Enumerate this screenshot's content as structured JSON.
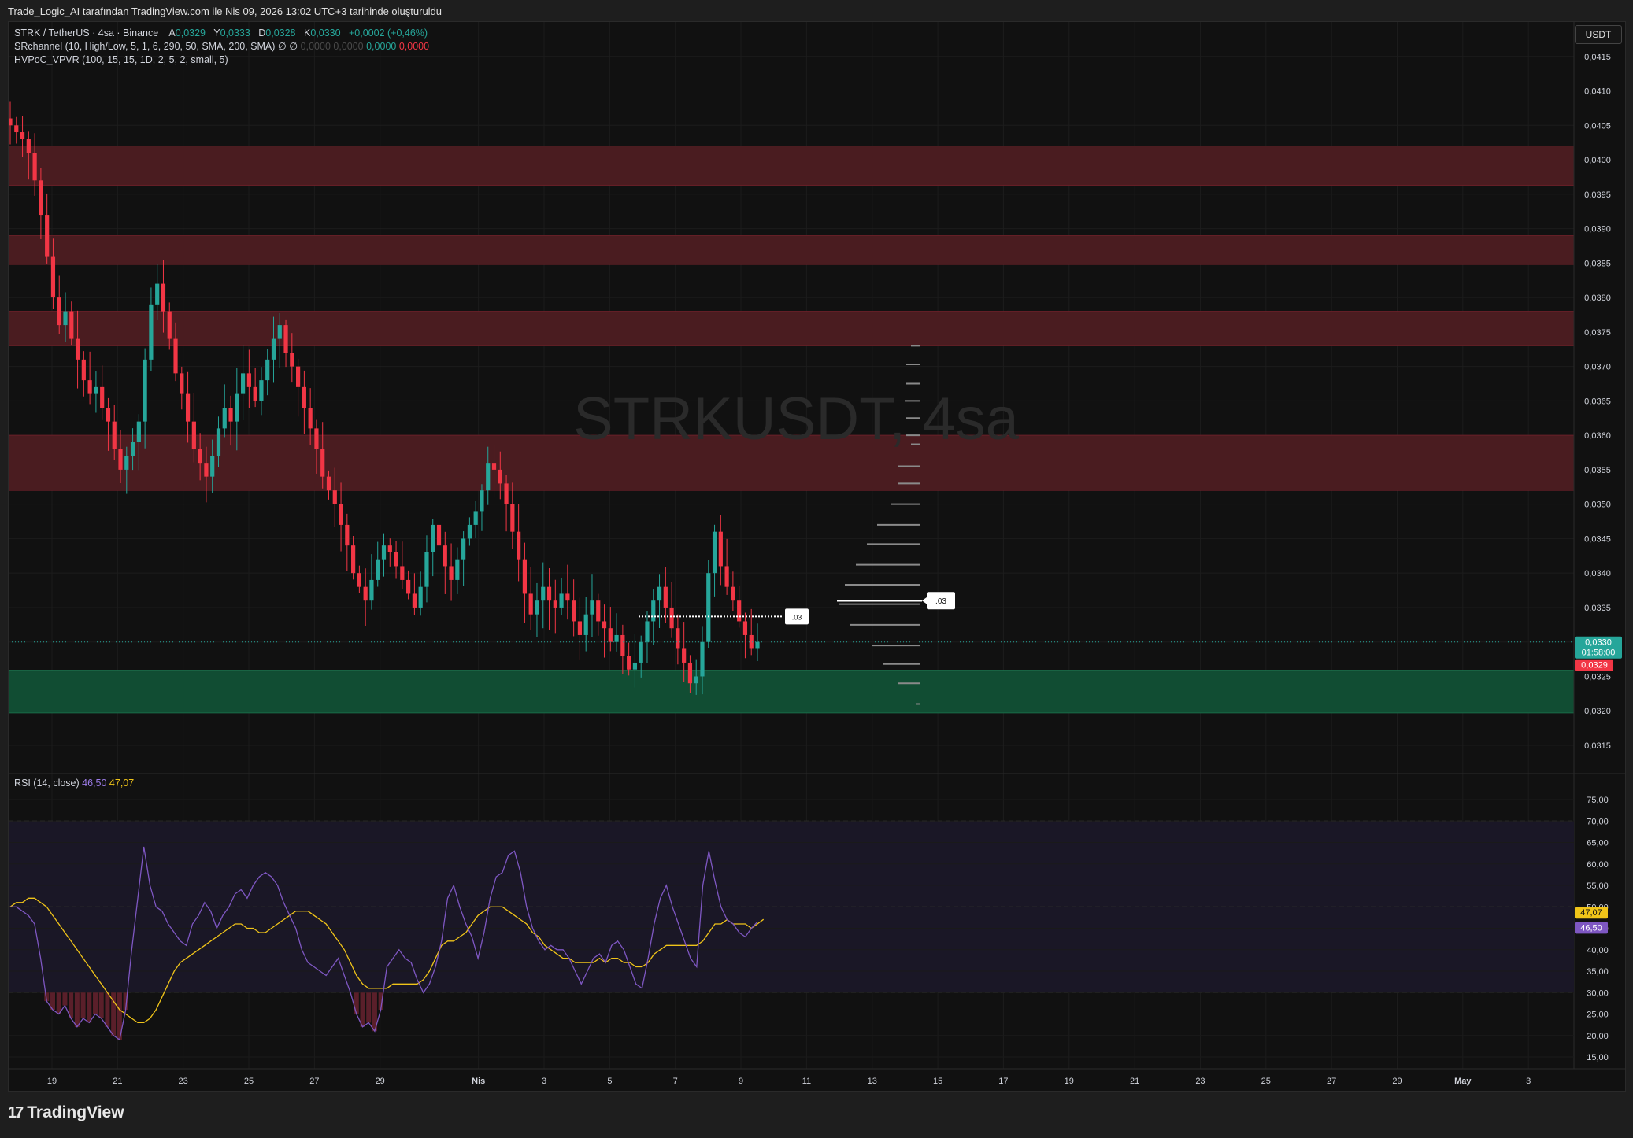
{
  "caption": "Trade_Logic_AI tarafından TradingView.com ile Nis 09, 2026 13:02 UTC+3 tarihinde oluşturuldu",
  "currency_button": "USDT",
  "watermark": "STRKUSDT, 4sa",
  "footer_logo": "TradingView",
  "legend": {
    "symbol": "STRK / TetherUS · 4sa · Binance",
    "ohlc": [
      {
        "k": "A",
        "v": "0,0329"
      },
      {
        "k": "Y",
        "v": "0,0333"
      },
      {
        "k": "D",
        "v": "0,0328"
      },
      {
        "k": "K",
        "v": "0,0330"
      }
    ],
    "change": "+0,0002 (+0,46%)",
    "srchannel": "SRchannel (10, High/Low, 5, 1, 6, 290, 50, SMA, 200, SMA)",
    "sr_icons": "∅  ∅",
    "sr_values": {
      "v1": "0,0000",
      "v2": "0,0000",
      "v3": "0,0000",
      "v4": "0,0000"
    },
    "hvpoc": "HVPoC_VPVR (100, 15, 15, 1D, 2, 5, 2, small, 5)"
  },
  "rsi_legend": {
    "name": "RSI (14, close)",
    "rsi": "46,50",
    "ma": "47,07"
  },
  "colors": {
    "up": "#26a69a",
    "down": "#f23645",
    "resistance": "#4a1c20",
    "support": "#114d33",
    "rsi": "#7e57c2",
    "rsi_ma": "#f0c419"
  },
  "chart_data": [
    {
      "type": "candlestick",
      "title": "STRK / TetherUS · 4sa · Binance",
      "ylim": [
        0.0311,
        0.042
      ],
      "y_ticks": [
        "0,0415",
        "0,0410",
        "0,0405",
        "0,0400",
        "0,0395",
        "0,0390",
        "0,0385",
        "0,0380",
        "0,0375",
        "0,0370",
        "0,0365",
        "0,0360",
        "0,0355",
        "0,0350",
        "0,0345",
        "0,0340",
        "0,0335",
        "0,0330",
        "0,0325",
        "0,0320",
        "0,0315"
      ],
      "x_ticks": [
        {
          "day": 19,
          "label": "19"
        },
        {
          "day": 21,
          "label": "21"
        },
        {
          "day": 23,
          "label": "23"
        },
        {
          "day": 25,
          "label": "25"
        },
        {
          "day": 27,
          "label": "27"
        },
        {
          "day": 29,
          "label": "29"
        },
        {
          "day": 32,
          "label": "Nis"
        },
        {
          "day": 34,
          "label": "3"
        },
        {
          "day": 36,
          "label": "5"
        },
        {
          "day": 38,
          "label": "7"
        },
        {
          "day": 40,
          "label": "9"
        },
        {
          "day": 42,
          "label": "11"
        },
        {
          "day": 44,
          "label": "13"
        },
        {
          "day": 46,
          "label": "15"
        },
        {
          "day": 48,
          "label": "17"
        },
        {
          "day": 50,
          "label": "19"
        },
        {
          "day": 52,
          "label": "21"
        },
        {
          "day": 54,
          "label": "23"
        },
        {
          "day": 56,
          "label": "25"
        },
        {
          "day": 58,
          "label": "27"
        },
        {
          "day": 60,
          "label": "29"
        },
        {
          "day": 62,
          "label": "May"
        },
        {
          "day": 64,
          "label": "3"
        }
      ],
      "zones": [
        {
          "kind": "resistance",
          "low": 0.03963,
          "high": 0.0402
        },
        {
          "kind": "resistance",
          "low": 0.03848,
          "high": 0.0389
        },
        {
          "kind": "resistance",
          "low": 0.0373,
          "high": 0.0378
        },
        {
          "kind": "resistance",
          "low": 0.0352,
          "high": 0.036
        },
        {
          "kind": "support",
          "low": 0.03197,
          "high": 0.03259
        }
      ],
      "closes": [
        0.0405,
        0.0404,
        0.0403,
        0.0401,
        0.0397,
        0.0392,
        0.0386,
        0.038,
        0.0376,
        0.0378,
        0.0374,
        0.0371,
        0.0368,
        0.0366,
        0.0367,
        0.0364,
        0.0362,
        0.0358,
        0.0355,
        0.0357,
        0.0359,
        0.0362,
        0.0371,
        0.0379,
        0.0382,
        0.0378,
        0.0374,
        0.0369,
        0.0366,
        0.0362,
        0.0358,
        0.0356,
        0.0354,
        0.0357,
        0.0361,
        0.0364,
        0.0362,
        0.0366,
        0.0369,
        0.0367,
        0.0365,
        0.0368,
        0.0371,
        0.0374,
        0.0376,
        0.0372,
        0.037,
        0.0367,
        0.0364,
        0.0361,
        0.0358,
        0.0354,
        0.0352,
        0.035,
        0.0347,
        0.0344,
        0.034,
        0.0338,
        0.0336,
        0.0339,
        0.0342,
        0.0344,
        0.0343,
        0.0341,
        0.0339,
        0.0337,
        0.0335,
        0.0338,
        0.0343,
        0.0347,
        0.0344,
        0.0341,
        0.0339,
        0.0342,
        0.0345,
        0.0347,
        0.0349,
        0.0352,
        0.0356,
        0.0355,
        0.0353,
        0.035,
        0.0346,
        0.0342,
        0.0337,
        0.0334,
        0.0336,
        0.0338,
        0.0336,
        0.0335,
        0.0337,
        0.0336,
        0.0333,
        0.0331,
        0.0334,
        0.0336,
        0.0333,
        0.0332,
        0.033,
        0.0331,
        0.0328,
        0.0326,
        0.0327,
        0.033,
        0.0333,
        0.0336,
        0.0338,
        0.0335,
        0.0332,
        0.0329,
        0.0327,
        0.0324,
        0.0325,
        0.033,
        0.034,
        0.0346,
        0.0341,
        0.0338,
        0.0336,
        0.0333,
        0.0331,
        0.0329,
        0.033
      ],
      "rsi_panel": {
        "ylim": [
          15,
          75
        ],
        "y_ticks": [
          "75,00",
          "70,00",
          "65,00",
          "60,00",
          "55,00",
          "50,00",
          "45,00",
          "40,00",
          "35,00",
          "30,00",
          "25,00",
          "20,00",
          "15,00"
        ],
        "bands": [
          70,
          50,
          30
        ],
        "rsi": [
          50,
          50,
          49,
          48,
          46,
          38,
          28,
          26,
          25,
          27,
          24,
          22,
          24,
          23,
          25,
          24,
          22,
          20,
          19,
          26,
          40,
          52,
          64,
          55,
          50,
          49,
          46,
          44,
          42,
          41,
          46,
          48,
          51,
          49,
          45,
          48,
          50,
          53,
          54,
          52,
          55,
          57,
          58,
          57,
          55,
          51,
          48,
          45,
          40,
          37,
          36,
          35,
          34,
          36,
          38,
          34,
          30,
          25,
          22,
          23,
          21,
          26,
          36,
          38,
          40,
          38,
          37,
          33,
          30,
          32,
          36,
          42,
          52,
          55,
          50,
          46,
          43,
          38,
          44,
          52,
          57,
          58,
          62,
          63,
          58,
          50,
          45,
          42,
          40,
          41,
          40,
          40,
          38,
          35,
          32,
          35,
          38,
          39,
          37,
          41,
          42,
          40,
          36,
          32,
          31,
          38,
          46,
          52,
          55,
          50,
          46,
          42,
          38,
          36,
          55,
          63,
          56,
          50,
          47,
          46,
          44,
          43,
          45,
          46.5
        ],
        "rsi_ma": [
          50,
          51,
          51,
          52,
          52,
          51,
          50,
          48,
          46,
          44,
          42,
          40,
          38,
          36,
          34,
          32,
          30,
          28,
          26,
          25,
          24,
          23,
          23,
          24,
          26,
          29,
          32,
          35,
          37,
          38,
          39,
          40,
          41,
          42,
          43,
          44,
          45,
          46,
          46,
          45,
          45,
          44,
          44,
          45,
          46,
          47,
          48,
          49,
          49,
          49,
          48,
          47,
          46,
          44,
          42,
          40,
          37,
          34,
          32,
          31,
          31,
          31,
          31,
          32,
          32,
          32,
          32,
          32,
          33,
          35,
          38,
          41,
          42,
          42,
          43,
          44,
          46,
          48,
          49,
          50,
          50,
          50,
          49,
          48,
          47,
          46,
          44,
          43,
          41,
          40,
          39,
          38,
          38,
          37,
          37,
          37,
          37,
          38,
          37,
          38,
          38,
          37,
          37,
          36,
          36,
          37,
          39,
          40,
          41,
          41,
          41,
          41,
          41,
          41,
          42,
          44,
          46,
          46,
          47,
          46,
          46,
          46,
          45,
          46,
          47.07
        ]
      },
      "volume_profile": {
        "poc_label": ".03",
        "levels": [
          {
            "price": 0.0373,
            "w": 12
          },
          {
            "price": 0.03703,
            "w": 18
          },
          {
            "price": 0.03675,
            "w": 18
          },
          {
            "price": 0.0365,
            "w": 20
          },
          {
            "price": 0.03625,
            "w": 18
          },
          {
            "price": 0.036,
            "w": 18
          },
          {
            "price": 0.03587,
            "w": 12
          },
          {
            "price": 0.03555,
            "w": 28
          },
          {
            "price": 0.0353,
            "w": 28
          },
          {
            "price": 0.035,
            "w": 38
          },
          {
            "price": 0.0347,
            "w": 55
          },
          {
            "price": 0.03442,
            "w": 68
          },
          {
            "price": 0.03412,
            "w": 82
          },
          {
            "price": 0.03383,
            "w": 96
          },
          {
            "price": 0.03355,
            "w": 104
          },
          {
            "price": 0.03325,
            "w": 90
          },
          {
            "price": 0.03295,
            "w": 62
          },
          {
            "price": 0.03268,
            "w": 48
          },
          {
            "price": 0.0324,
            "w": 28
          },
          {
            "price": 0.0321,
            "w": 6
          }
        ]
      },
      "current_price_label": ".03",
      "price_badges": [
        {
          "text": "0,0330",
          "sub": "01:58:00",
          "kind": "up"
        },
        {
          "text": "0,0329",
          "kind": "down"
        }
      ],
      "rsi_badges": [
        {
          "text": "47,07",
          "kind": "ma"
        },
        {
          "text": "46,50",
          "kind": "rsi"
        }
      ]
    }
  ]
}
